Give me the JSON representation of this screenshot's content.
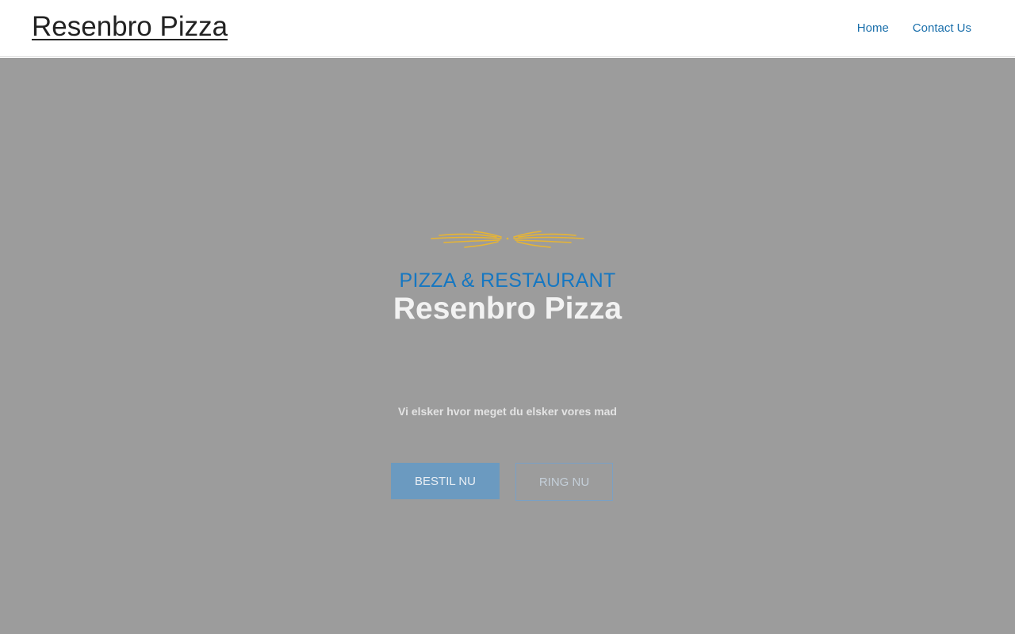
{
  "header": {
    "site_title": "Resenbro Pizza",
    "nav": [
      {
        "label": "Home"
      },
      {
        "label": "Contact Us"
      }
    ]
  },
  "hero": {
    "ornament_icon": "wheat-flourish-icon",
    "kicker": "PIZZA & RESTAURANT",
    "title": "Resenbro Pizza",
    "tagline": "Vi elsker hvor meget du elsker vores mad",
    "buttons": {
      "primary_label": "BESTIL NU",
      "secondary_label": "RING NU"
    }
  },
  "colors": {
    "accent": "#1577c2",
    "nav_link": "#1a6fab",
    "hero_overlay": "#9c9c9c",
    "ornament": "#e8b533"
  }
}
